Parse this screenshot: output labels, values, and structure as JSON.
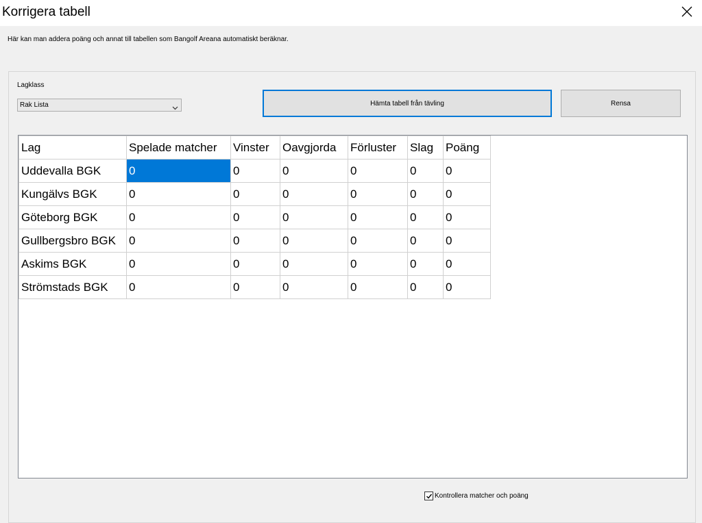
{
  "window": {
    "title": "Korrigera tabell",
    "close_icon": "close-icon"
  },
  "info_text": "Här kan man addera poäng och annat till tabellen som Bangolf Areana automatiskt beräknar.",
  "lagklass": {
    "label": "Lagklass",
    "selected": "Rak Lista"
  },
  "buttons": {
    "fetch": "Hämta tabell från tävling",
    "clear": "Rensa"
  },
  "table": {
    "columns": [
      "Lag",
      "Spelade matcher",
      "Vinster",
      "Oavgjorda",
      "Förluster",
      "Slag",
      "Poäng"
    ],
    "rows": [
      [
        "Uddevalla BGK",
        "0",
        "0",
        "0",
        "0",
        "0",
        "0"
      ],
      [
        "Kungälvs BGK",
        "0",
        "0",
        "0",
        "0",
        "0",
        "0"
      ],
      [
        "Göteborg BGK",
        "0",
        "0",
        "0",
        "0",
        "0",
        "0"
      ],
      [
        "Gullbergsbro BGK",
        "0",
        "0",
        "0",
        "0",
        "0",
        "0"
      ],
      [
        "Askims BGK",
        "0",
        "0",
        "0",
        "0",
        "0",
        "0"
      ],
      [
        "Strömstads BGK",
        "0",
        "0",
        "0",
        "0",
        "0",
        "0"
      ]
    ]
  },
  "checkbox": {
    "label": "Kontrollera matcher och poäng",
    "checked": true
  },
  "colors": {
    "accent": "#0078d7",
    "background": "#f0f0f0"
  }
}
